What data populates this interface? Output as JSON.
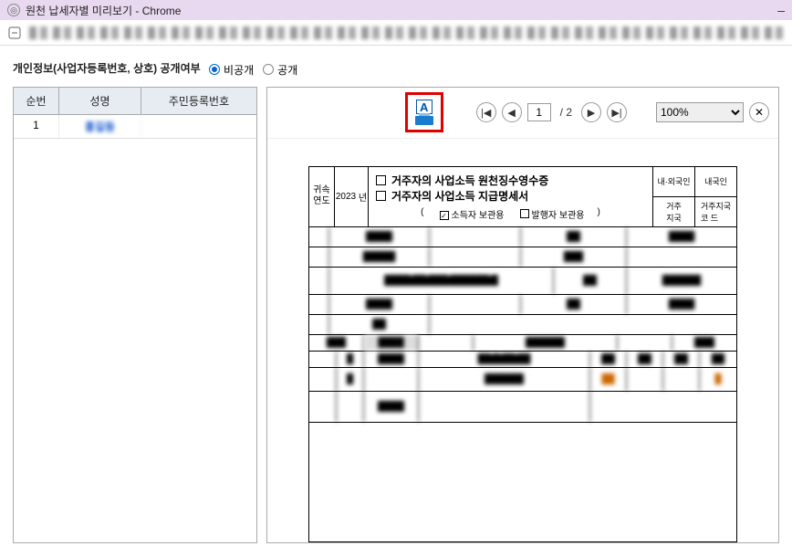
{
  "window": {
    "title": "원천 납세자별 미리보기 - Chrome",
    "minimize": "–"
  },
  "options": {
    "label": "개인정보(사업자등록번호, 상호) 공개여부",
    "private": "비공개",
    "public": "공개"
  },
  "left": {
    "headers": {
      "no": "순번",
      "name": "성명",
      "rrn": "주민등록번호"
    },
    "rows": [
      {
        "no": "1",
        "name": "홍길동",
        "rrn": ""
      }
    ]
  },
  "toolbar": {
    "page_current": "1",
    "page_total": "/ 2",
    "zoom": "100%",
    "first": "|◀",
    "prev": "◀",
    "next": "▶",
    "last": "▶|",
    "close": "✕"
  },
  "doc": {
    "year_label": "귀속\n연도",
    "year": "2023",
    "year_suffix": "년",
    "title1": "거주자의 사업소득 원천징수영수증",
    "title2": "거주자의 사업소득 지급명세서",
    "keep1": "소득자 보관용",
    "keep2": "발행자 보관용",
    "paren_l": "(",
    "paren_r": ")",
    "check": "✓",
    "r1a": "내·외국인",
    "r1b": "내국인",
    "r2a": "거주\n지국",
    "r2b": "거주지국\n코  드"
  }
}
